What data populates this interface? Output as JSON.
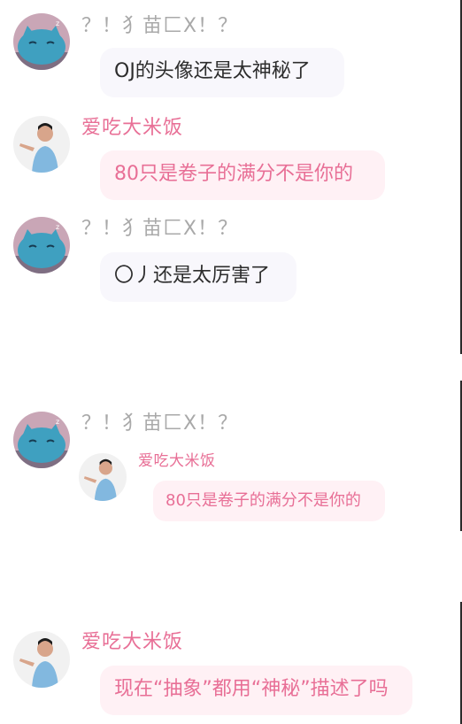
{
  "messages": [
    {
      "sender": "？！犭苗匚X！？",
      "text": "OJ的头像还是太神秘了"
    },
    {
      "sender": "爱吃大米饭",
      "text": "80只是卷子的满分不是你的"
    },
    {
      "sender": "？！犭苗匚X！？",
      "text": "〇丿还是太厉害了"
    },
    {
      "sender": "？！犭苗匚X！？",
      "forwarded": {
        "sender": "爱吃大米饭",
        "text": "80只是卷子的满分不是你的"
      }
    },
    {
      "sender": "爱吃大米饭",
      "text": "现在“抽象”都用“神秘”描述了吗"
    }
  ],
  "colors": {
    "pink_text": "#e86f96",
    "pink_bubble": "#fff1f5",
    "gray_name": "#a9a9a9",
    "gray_bubble": "#f8f7fc",
    "blue_avatar": "#3fa0c0"
  },
  "icons": {
    "cat_avatar": "blue-cat-avatar-icon",
    "person_avatar": "person-photo-avatar-icon"
  }
}
